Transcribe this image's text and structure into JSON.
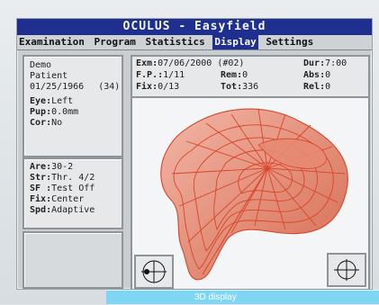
{
  "window": {
    "title": "OCULUS - Easyfield"
  },
  "menu": {
    "items": [
      "Examination",
      "Program",
      "Statistics",
      "Display",
      "Settings"
    ],
    "active": "Display"
  },
  "patient": {
    "line1": "Demo",
    "line2": "Patient",
    "dob": "01/25/1966",
    "age": "(34)",
    "eye_label": "Eye",
    "eye_value": "Left",
    "pup_label": "Pup",
    "pup_value": "0.0mm",
    "cor_label": "Cor",
    "cor_value": "No"
  },
  "test": {
    "are_label": "Are",
    "are_value": "30-2",
    "str_label": "Str",
    "str_value": "Thr. 4/2",
    "sf_label": "SF",
    "sf_value": "Test Off",
    "fix_label": "Fix",
    "fix_value": "Center",
    "spd_label": "Spd",
    "spd_value": "Adaptive"
  },
  "exam": {
    "exm_label": "Exm",
    "exm_value": "07/06/2000 (#02)",
    "fp_label": "F.P.",
    "fp_value": "1/11",
    "fix_label": "Fix",
    "fix_value": "0/13",
    "dur_label": "Dur",
    "dur_value": "7:00",
    "rem_label": "Rem",
    "rem_value": "0",
    "tot_label": "Tot",
    "tot_value": "336",
    "abs_label": "Abs",
    "abs_value": "0",
    "rel_label": "Rel",
    "rel_value": "0"
  },
  "overlay": {
    "text": "3D display"
  },
  "colors": {
    "titlebar": "#1f2f8f",
    "mesh": "#d9452b",
    "mesh_fill": "#e78a73"
  },
  "icons": {
    "left_corner": "fixation-target-icon",
    "right_corner": "crosshair-icon"
  }
}
